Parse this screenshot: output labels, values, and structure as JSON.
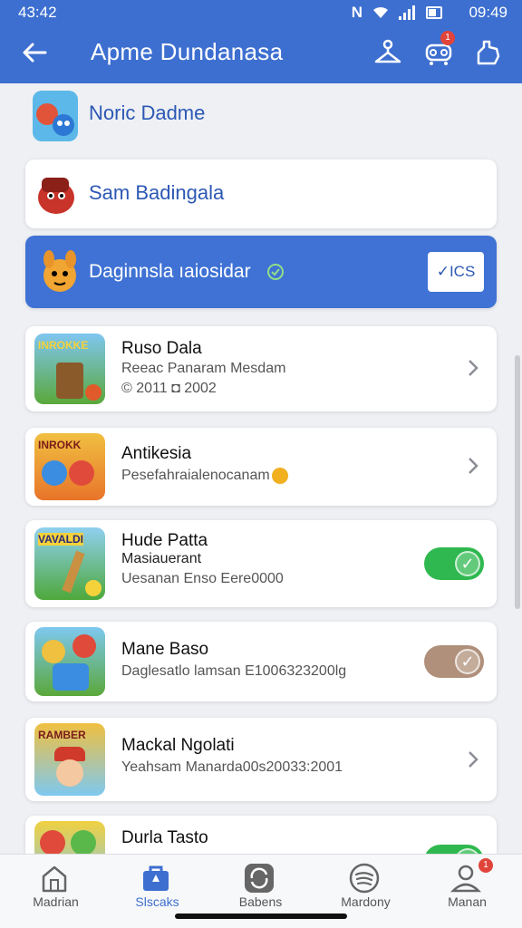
{
  "status_bar": {
    "time_left": "43:42",
    "time_right": "09:49"
  },
  "header": {
    "title": "Apme Dundanasa",
    "badge": "1"
  },
  "sections": [
    {
      "title": "Noric Dadme"
    },
    {
      "title": "Sam Badingala"
    },
    {
      "title": "Daginnsla ıaiosidar",
      "check_label": "✓ICS"
    }
  ],
  "games": [
    {
      "title": "Ruso Dala",
      "line1": "Reeac Panaram Mesdam",
      "line2": "© 2011 ◘ 2002",
      "control": "chevron",
      "thumb_text": "INROKKE"
    },
    {
      "title": "Antikesia",
      "line1": "Pesefahraialenocanam",
      "line2": "",
      "control": "chevron",
      "thumb_text": "INROKK"
    },
    {
      "title": "Hude Patta",
      "line1": "Masiauerant",
      "line2": "Uesanan Enso Eere0000",
      "control": "toggle-on",
      "thumb_text": "VAVALDI"
    },
    {
      "title": "Mane Baso",
      "line1": "Daglesatlo lamsan E1006323200lg",
      "line2": "",
      "control": "toggle-brown",
      "thumb_text": ""
    },
    {
      "title": "Mackal Ngolati",
      "line1": "Yeahsam Manarda00s20033:2001",
      "line2": "",
      "control": "chevron",
      "thumb_text": "RAMBER"
    },
    {
      "title": "Durla Tasto",
      "line1": "",
      "line2": "",
      "control": "toggle-on",
      "thumb_text": ""
    }
  ],
  "nav": [
    {
      "label": "Madrian",
      "icon": "home-icon"
    },
    {
      "label": "Slscaks",
      "icon": "store-icon",
      "active": true
    },
    {
      "label": "Babens",
      "icon": "sync-icon"
    },
    {
      "label": "Mardony",
      "icon": "spotify-icon"
    },
    {
      "label": "Manan",
      "icon": "profile-icon",
      "badge": "1"
    }
  ],
  "colors": {
    "primary": "#3d6fd0",
    "toggle_on": "#2fb84f",
    "toggle_brown": "#b0907a"
  }
}
